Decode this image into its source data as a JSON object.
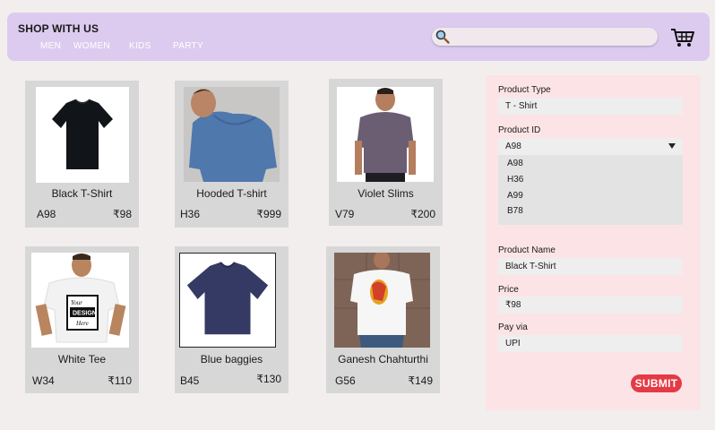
{
  "header": {
    "brand": "SHOP WITH US",
    "nav": [
      "MEN",
      "WOMEN",
      "KIDS",
      "PARTY"
    ],
    "search": {
      "value": "",
      "placeholder": ""
    },
    "cart_icon": "cart-icon",
    "search_icon": "magnifier-icon"
  },
  "products": [
    {
      "name": "Black T-Shirt",
      "id": "A98",
      "price": "₹98"
    },
    {
      "name": "Hooded T-shirt",
      "id": "H36",
      "price": "₹999"
    },
    {
      "name": "Violet Slims",
      "id": "V79",
      "price": "₹200"
    },
    {
      "name": "White Tee",
      "id": "W34",
      "price": "₹110"
    },
    {
      "name": "Blue baggies",
      "id": "B45",
      "price": "₹130"
    },
    {
      "name": "Ganesh Chahturthi",
      "id": "G56",
      "price": "₹149"
    }
  ],
  "form": {
    "product_type_label": "Product Type",
    "product_type_value": "T - Shirt",
    "product_id_label": "Product ID",
    "product_id_value": "A98",
    "product_id_options": [
      "A98",
      "H36",
      "A99",
      "B78"
    ],
    "product_name_label": "Product Name",
    "product_name_value": "Black T-Shirt",
    "price_label": "Price",
    "price_value": "₹98",
    "pay_label": "Pay via",
    "pay_value": "UPI",
    "submit_label": "SUBMIT"
  },
  "colors": {
    "header_bg": "#dccbef",
    "form_bg": "#fce4e6",
    "submit_bg": "#e43a46",
    "card_bg": "#d7d7d7"
  }
}
